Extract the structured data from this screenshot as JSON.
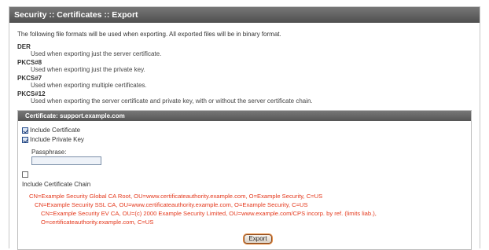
{
  "panel": {
    "title": "Security :: Certificates :: Export"
  },
  "intro": "The following file formats will be used when exporting. All exported files will be in binary format.",
  "formats": [
    {
      "name": "DER",
      "desc": "Used when exporting just the server certificate."
    },
    {
      "name": "PKCS#8",
      "desc": "Used when exporting just the private key."
    },
    {
      "name": "PKCS#7",
      "desc": "Used when exporting multiple certificates."
    },
    {
      "name": "PKCS#12",
      "desc": "Used when exporting the server certificate and private key, with or without the server certificate chain."
    }
  ],
  "cert": {
    "header": "Certificate: support.example.com",
    "include_certificate": {
      "label": "Include Certificate",
      "checked": true
    },
    "include_private_key": {
      "label": "Include Private Key",
      "checked": true
    },
    "passphrase": {
      "label": "Passphrase:",
      "value": ""
    },
    "include_chain": {
      "label": "Include Certificate Chain",
      "checked": false
    },
    "chain": [
      "CN=Example Security Global CA Root, OU=www.certificateauthority.example.com, O=Example Security, C=US",
      "CN=Example Security SSL CA, OU=www.certificateauthority.example.com, O=Example Security, C=US",
      "CN=Example Security EV CA, OU=(c) 2000 Example Security Limited, OU=www.example.com/CPS incorp. by ref. (limits liab.),",
      "O=certificateauthority.example.com, C=US"
    ],
    "chain_color": "#e4381c",
    "export_label": "Export"
  },
  "colors": {
    "header_bg": "#5a5a5a",
    "accent": "#e88a3a"
  }
}
